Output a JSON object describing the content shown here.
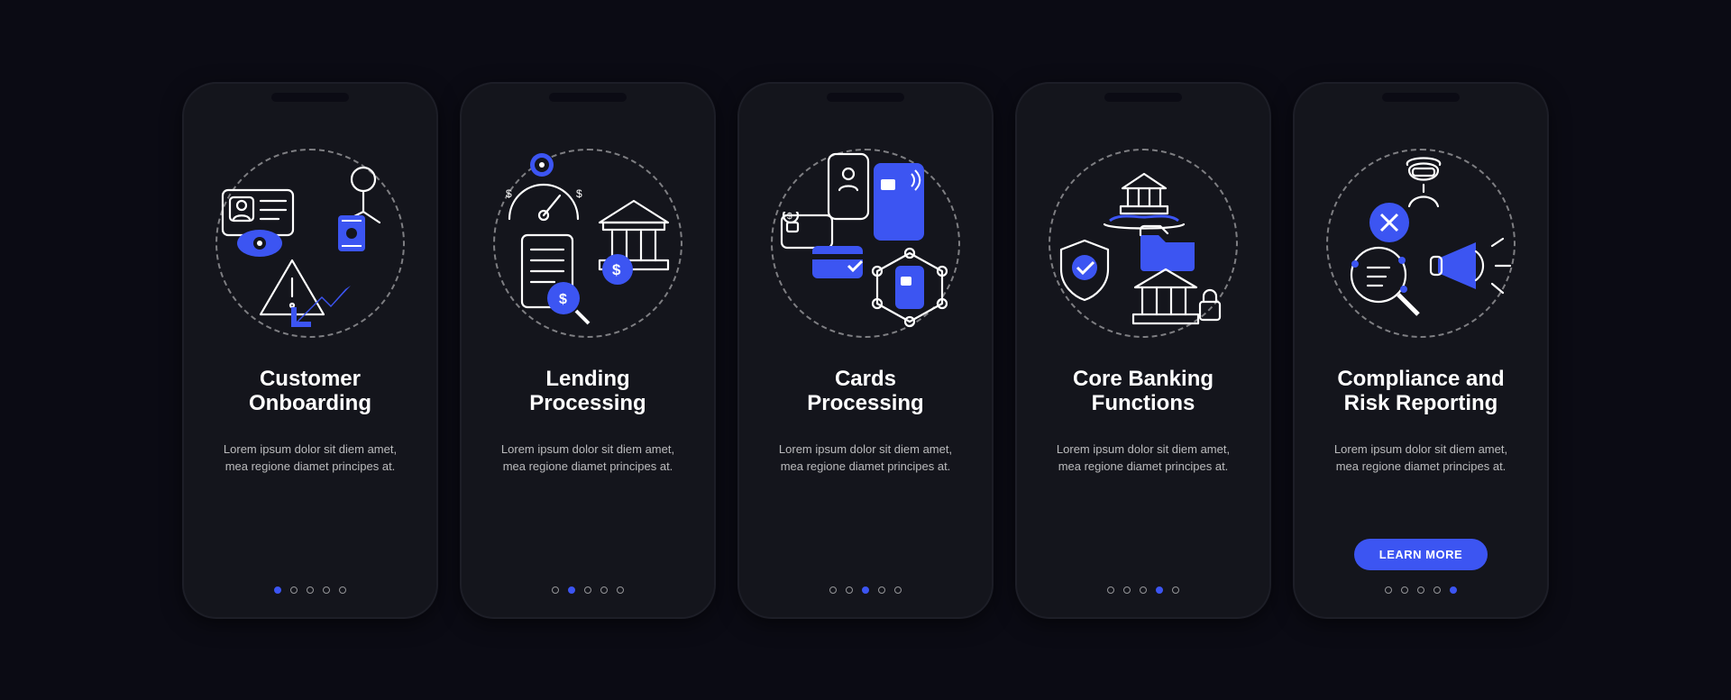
{
  "accent": "#3c55f2",
  "body_text": "Lorem ipsum dolor sit diem amet, mea regione diamet principes at.",
  "cta_label": "LEARN MORE",
  "total_dots": 5,
  "screens": [
    {
      "icon": "customer-onboarding-icon",
      "title": "Customer\nOnboarding",
      "active_dot": 0,
      "show_cta": false
    },
    {
      "icon": "lending-processing-icon",
      "title": "Lending\nProcessing",
      "active_dot": 1,
      "show_cta": false
    },
    {
      "icon": "cards-processing-icon",
      "title": "Cards\nProcessing",
      "active_dot": 2,
      "show_cta": false
    },
    {
      "icon": "core-banking-icon",
      "title": "Core Banking\nFunctions",
      "active_dot": 3,
      "show_cta": false
    },
    {
      "icon": "compliance-risk-icon",
      "title": "Compliance and\nRisk Reporting",
      "active_dot": 4,
      "show_cta": true
    }
  ]
}
